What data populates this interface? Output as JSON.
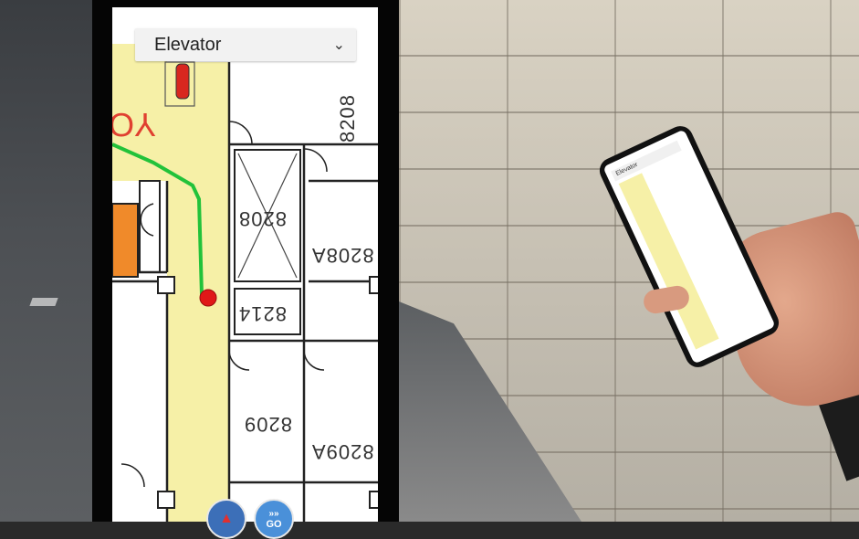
{
  "dropdown": {
    "selected": "Elevator"
  },
  "rooms": {
    "r8208": "8208",
    "r8208_shaft": "8208",
    "r8208A": "8208A",
    "r8214": "8214",
    "r8209": "8209",
    "r8209A": "8209A"
  },
  "fabs": {
    "go_label": "GO"
  },
  "small_phone": {
    "dropdown": "Elevator"
  },
  "colors": {
    "corridor": "#f6f0a7",
    "route": "#22c23a",
    "marker": "#e01818",
    "fab": "#4a90d9"
  }
}
